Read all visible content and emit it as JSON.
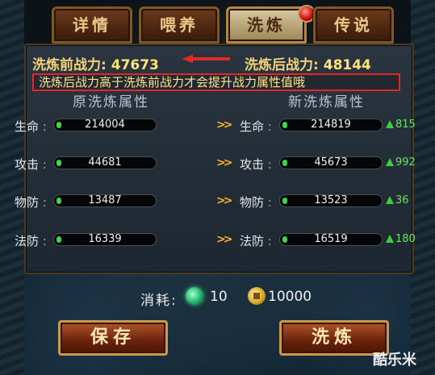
{
  "tabs": [
    {
      "label": "详情",
      "active": false
    },
    {
      "label": "喂养",
      "active": false
    },
    {
      "label": "洗炼",
      "active": true
    },
    {
      "label": "传说",
      "active": false
    }
  ],
  "power": {
    "before_label": "洗炼前战力:",
    "before_value": "47673",
    "after_label": "洗炼后战力:",
    "after_value": "48144"
  },
  "hint": "洗炼后战力高于洗炼前战力才会提升战力属性值哦",
  "columns": {
    "original": "原洗炼属性",
    "new": "新洗炼属性"
  },
  "stats": [
    {
      "label": "生命",
      "old": "214004",
      "new": "214819",
      "gain": "815"
    },
    {
      "label": "攻击",
      "old": "44681",
      "new": "45673",
      "gain": "992"
    },
    {
      "label": "物防",
      "old": "13487",
      "new": "13523",
      "gain": "36"
    },
    {
      "label": "法防",
      "old": "16339",
      "new": "16519",
      "gain": "180"
    }
  ],
  "cost": {
    "label": "消耗:",
    "gem_amount": "10",
    "coin_amount": "10000"
  },
  "buttons": {
    "save": "保存",
    "refine": "洗炼"
  },
  "watermark": "酷乐米",
  "colors": {
    "accent_gold": "#f2d27a",
    "gain_green": "#6fe06a",
    "hint_border": "#e2262a"
  }
}
